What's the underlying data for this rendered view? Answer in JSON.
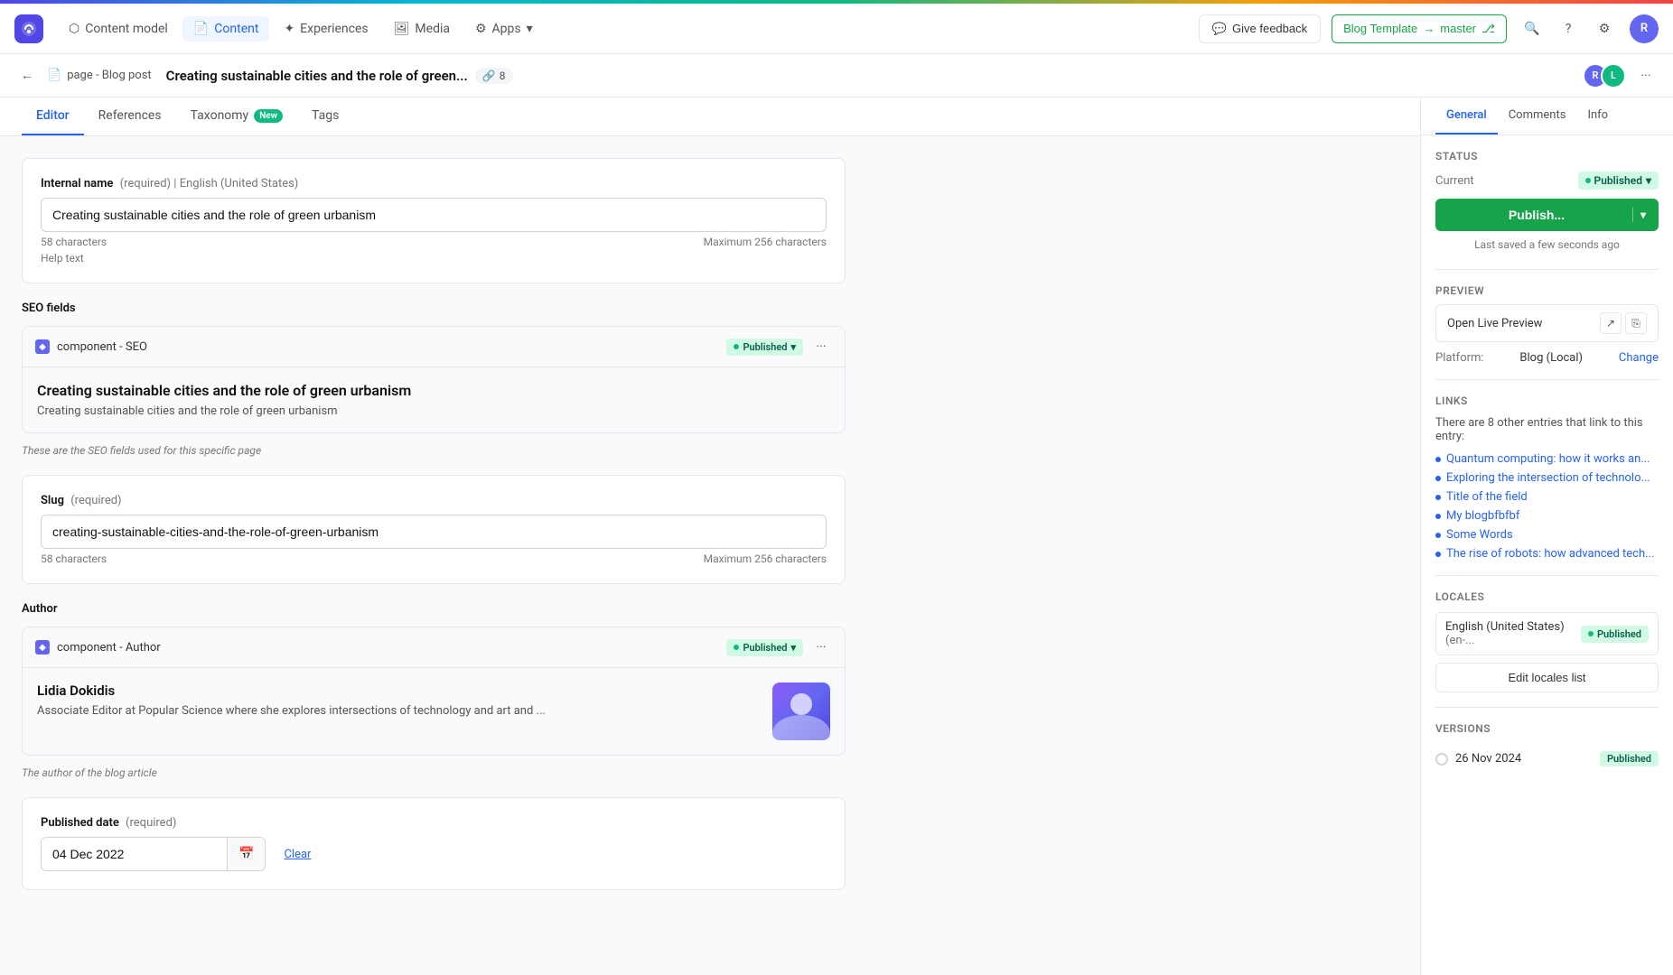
{
  "gradient": {},
  "topNav": {
    "logo": "C",
    "items": [
      {
        "id": "content-model",
        "label": "Content model",
        "icon": "⬡",
        "active": false
      },
      {
        "id": "content",
        "label": "Content",
        "icon": "📄",
        "active": true
      },
      {
        "id": "experiences",
        "label": "Experiences",
        "icon": "✦",
        "active": false
      },
      {
        "id": "media",
        "label": "Media",
        "icon": "🖼",
        "active": false
      },
      {
        "id": "apps",
        "label": "Apps",
        "icon": "⚙",
        "active": false,
        "hasDropdown": true
      }
    ],
    "giveFeedback": "Give feedback",
    "blogTemplate": "Blog Template",
    "branchName": "master",
    "avatar": "R"
  },
  "secondaryNav": {
    "breadcrumb": "page - Blog post",
    "pageTitle": "Creating sustainable cities and the role of green...",
    "linkCount": "8"
  },
  "tabs": [
    {
      "id": "editor",
      "label": "Editor",
      "active": true
    },
    {
      "id": "references",
      "label": "References",
      "active": false
    },
    {
      "id": "taxonomy",
      "label": "Taxonomy",
      "badge": "New",
      "active": false
    },
    {
      "id": "tags",
      "label": "Tags",
      "active": false
    }
  ],
  "form": {
    "internalNameSection": {
      "label": "Internal name",
      "required": "(required)",
      "locale": "English (United States)",
      "value": "Creating sustainable cities and the role of green urbanism",
      "charCount": "58 characters",
      "maxChars": "Maximum 256 characters",
      "helpText": "Help text"
    },
    "seoSection": {
      "label": "SEO fields",
      "component": {
        "name": "component - SEO",
        "status": "Published",
        "title": "Creating sustainable cities and the role of green urbanism",
        "description": "Creating sustainable cities and the role of green urbanism"
      },
      "note": "These are the SEO fields used for this specific page"
    },
    "slugSection": {
      "label": "Slug",
      "required": "(required)",
      "value": "creating-sustainable-cities-and-the-role-of-green-urbanism",
      "charCount": "58 characters",
      "maxChars": "Maximum 256 characters"
    },
    "authorSection": {
      "label": "Author",
      "component": {
        "name": "component - Author",
        "status": "Published",
        "authorName": "Lidia Dokidis",
        "authorBio": "Associate Editor at Popular Science where she explores intersections of technology and art and ..."
      },
      "note": "The author of the blog article"
    },
    "publishedDateSection": {
      "label": "Published date",
      "required": "(required)",
      "value": "04 Dec 2022",
      "clearLabel": "Clear"
    }
  },
  "sidebar": {
    "tabs": [
      {
        "id": "general",
        "label": "General",
        "active": true
      },
      {
        "id": "comments",
        "label": "Comments",
        "active": false
      },
      {
        "id": "info",
        "label": "Info",
        "active": false
      }
    ],
    "status": {
      "sectionTitle": "Status",
      "currentLabel": "Current",
      "currentValue": "Published",
      "publishButtonLabel": "Publish...",
      "lastSaved": "Last saved a few seconds ago"
    },
    "preview": {
      "sectionTitle": "Preview",
      "openButtonLabel": "Open Live Preview",
      "platformLabel": "Platform:",
      "platformValue": "Blog (Local)",
      "changeLabel": "Change"
    },
    "links": {
      "sectionTitle": "Links",
      "description": "There are 8 other entries that link to this entry:",
      "items": [
        "Quantum computing: how it works an...",
        "Exploring the intersection of technolo...",
        "Title of the field",
        "My blogbfbfbf",
        "Some Words",
        "The rise of robots: how advanced tech..."
      ]
    },
    "locales": {
      "sectionTitle": "Locales",
      "locale": "English (United States)",
      "localeCode": "(en-...",
      "localeStatus": "Published",
      "editLabel": "Edit locales list"
    },
    "versions": {
      "sectionTitle": "Versions",
      "items": [
        {
          "date": "26 Nov 2024",
          "status": "Published"
        }
      ]
    }
  }
}
